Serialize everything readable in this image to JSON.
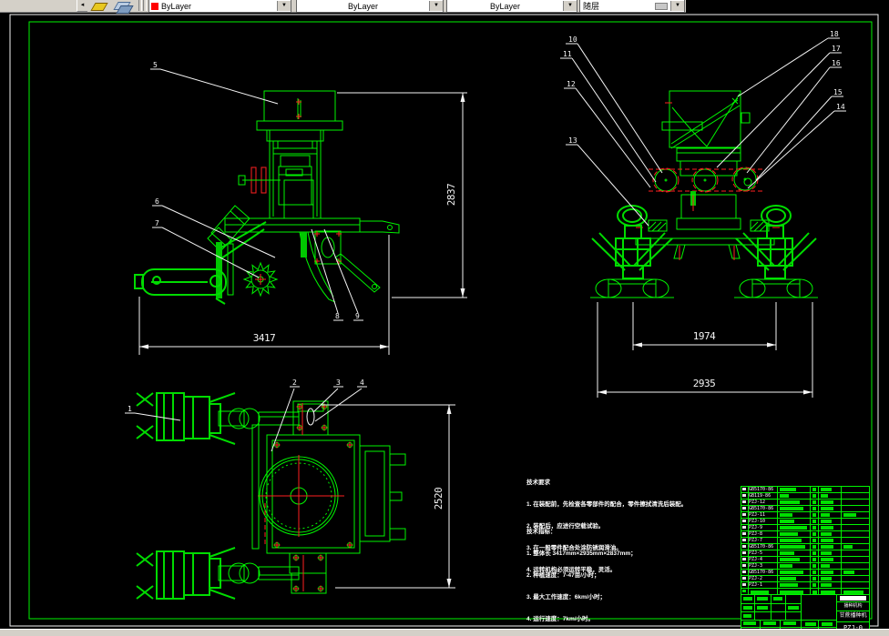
{
  "toolbar": {
    "overflow_fragment": "◂",
    "icons": [
      {
        "name": "make-object-layer-current-icon",
        "color": "#e8c820"
      },
      {
        "name": "layer-previous-icon",
        "color": "#9db8d2"
      }
    ],
    "color_dropdown": {
      "value": "ByLayer",
      "swatch_color": "#ff0000"
    },
    "linetype_dropdown": {
      "value": "ByLayer"
    },
    "lineweight_dropdown": {
      "value": "ByLayer"
    },
    "plot_style_dropdown": {
      "value": "随层"
    }
  },
  "drawing": {
    "balloons": [
      "1",
      "2",
      "3",
      "4",
      "5",
      "6",
      "7",
      "8",
      "9",
      "10",
      "11",
      "12",
      "13",
      "14",
      "15",
      "16",
      "17",
      "18"
    ],
    "dimensions": {
      "side_height": "2837",
      "side_length": "3417",
      "front_track": "1974",
      "front_width": "2935",
      "top_depth": "2520"
    },
    "notes_requirements": {
      "title": "技术要求",
      "items": [
        "1. 在装配前，先检查各零部件的配合，零件擦拭清洗后装配。",
        "2. 装配后，应进行空载试验。",
        "3. 在一般零件配合处涂防锈润滑油。",
        "4. 运转机构必须运转平稳，灵活。"
      ]
    },
    "notes_specs": {
      "title": "技术指标：",
      "items": [
        "1. 整体长 3417mm×2935mm×2837mm；",
        "2. 种植速度：7-47亩/小时；",
        "3. 最大工作速度：6km/小时；",
        "4. 运行速度：7km/小时。"
      ]
    }
  },
  "bom": {
    "rows": [
      {
        "code": "GB5170-86"
      },
      {
        "code": "GB119-86"
      },
      {
        "code": "PZJ-12"
      },
      {
        "code": "GB5170-86"
      },
      {
        "code": "PZJ-11"
      },
      {
        "code": "PZJ-10"
      },
      {
        "code": "PZJ-9"
      },
      {
        "code": "PZJ-8"
      },
      {
        "code": "PZJ-7"
      },
      {
        "code": "GB5170-86"
      },
      {
        "code": "PZJ-5"
      },
      {
        "code": "PZJ-4"
      },
      {
        "code": "PZJ-3"
      },
      {
        "code": "GB5170-86"
      },
      {
        "code": "PZJ-2"
      },
      {
        "code": "PZJ-1"
      }
    ]
  },
  "title_block": {
    "org": "播种机构",
    "product": "甘蔗播种机",
    "drawing_no": "PZJ-0"
  }
}
